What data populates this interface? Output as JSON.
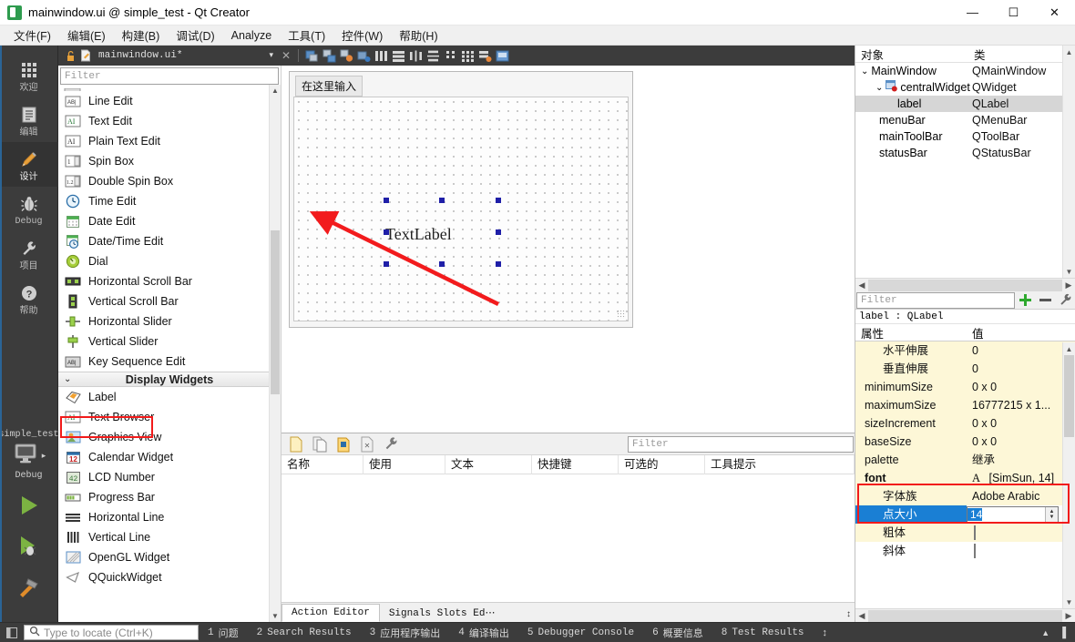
{
  "window": {
    "title": "mainwindow.ui @ simple_test - Qt Creator",
    "app_icon": "qt-creator-icon",
    "minimize": "—",
    "maximize": "☐",
    "close": "✕"
  },
  "menubar": {
    "items": [
      {
        "label": "文件(F)",
        "name": "menu-file"
      },
      {
        "label": "编辑(E)",
        "name": "menu-edit"
      },
      {
        "label": "构建(B)",
        "name": "menu-build"
      },
      {
        "label": "调试(D)",
        "name": "menu-debug"
      },
      {
        "label": "Analyze",
        "name": "menu-analyze"
      },
      {
        "label": "工具(T)",
        "name": "menu-tools"
      },
      {
        "label": "控件(W)",
        "name": "menu-window"
      },
      {
        "label": "帮助(H)",
        "name": "menu-help"
      }
    ]
  },
  "modebar": {
    "modes": [
      {
        "label": "欢迎",
        "icon": "grid-icon",
        "active": false
      },
      {
        "label": "编辑",
        "icon": "document-icon",
        "active": false
      },
      {
        "label": "设计",
        "icon": "pencil-icon",
        "active": true
      },
      {
        "label": "Debug",
        "icon": "bug-icon",
        "active": false
      },
      {
        "label": "项目",
        "icon": "wrench-icon",
        "active": false
      },
      {
        "label": "帮助",
        "icon": "question-icon",
        "active": false
      }
    ],
    "kit": {
      "project": "simple_test",
      "build_config": "Debug",
      "icon": "monitor-icon",
      "arrow": "▸"
    },
    "actions": [
      {
        "name": "run-button",
        "icon": "play-icon"
      },
      {
        "name": "debug-button",
        "icon": "play-bug-icon"
      },
      {
        "name": "build-button",
        "icon": "hammer-icon"
      }
    ]
  },
  "designer_toolbar": {
    "lock_icon": "unlock-icon",
    "file_icon": "ui-file-icon",
    "filename": "mainwindow.ui*",
    "dropdown_arrow": "▾",
    "close_label": "✕",
    "buttons": [
      {
        "name": "edit-widgets-button",
        "icon": "edit-widgets-icon"
      },
      {
        "name": "edit-signals-slots-button",
        "icon": "signals-slots-icon"
      },
      {
        "name": "edit-buddies-button",
        "icon": "buddies-icon"
      },
      {
        "name": "edit-tab-order-button",
        "icon": "tab-order-icon"
      },
      {
        "name": "layout-horizontally-button",
        "icon": "layout-h-icon"
      },
      {
        "name": "layout-vertically-button",
        "icon": "layout-v-icon"
      },
      {
        "name": "layout-splitter-h-button",
        "icon": "splitter-h-icon"
      },
      {
        "name": "layout-splitter-v-button",
        "icon": "splitter-v-icon"
      },
      {
        "name": "layout-form-button",
        "icon": "layout-form-icon"
      },
      {
        "name": "layout-grid-button",
        "icon": "layout-grid-icon"
      },
      {
        "name": "break-layout-button",
        "icon": "break-layout-icon"
      },
      {
        "name": "adjust-size-button",
        "icon": "adjust-size-icon"
      }
    ]
  },
  "widgetbox": {
    "filter_placeholder": "Filter",
    "items": [
      {
        "label": "Line Edit",
        "icon": "line-edit-icon"
      },
      {
        "label": "Text Edit",
        "icon": "text-edit-icon"
      },
      {
        "label": "Plain Text Edit",
        "icon": "plain-text-edit-icon"
      },
      {
        "label": "Spin Box",
        "icon": "spin-box-icon"
      },
      {
        "label": "Double Spin Box",
        "icon": "double-spin-box-icon"
      },
      {
        "label": "Time Edit",
        "icon": "time-edit-icon"
      },
      {
        "label": "Date Edit",
        "icon": "date-edit-icon"
      },
      {
        "label": "Date/Time Edit",
        "icon": "date-time-edit-icon"
      },
      {
        "label": "Dial",
        "icon": "dial-icon"
      },
      {
        "label": "Horizontal Scroll Bar",
        "icon": "h-scrollbar-icon"
      },
      {
        "label": "Vertical Scroll Bar",
        "icon": "v-scrollbar-icon"
      },
      {
        "label": "Horizontal Slider",
        "icon": "h-slider-icon"
      },
      {
        "label": "Vertical Slider",
        "icon": "v-slider-icon"
      },
      {
        "label": "Key Sequence Edit",
        "icon": "key-sequence-edit-icon"
      }
    ],
    "category": {
      "label": "Display Widgets",
      "chevron": "⌄"
    },
    "display_items": [
      {
        "label": "Label",
        "icon": "label-icon",
        "highlighted": true
      },
      {
        "label": "Text Browser",
        "icon": "text-browser-icon"
      },
      {
        "label": "Graphics View",
        "icon": "graphics-view-icon"
      },
      {
        "label": "Calendar Widget",
        "icon": "calendar-widget-icon"
      },
      {
        "label": "LCD Number",
        "icon": "lcd-number-icon"
      },
      {
        "label": "Progress Bar",
        "icon": "progress-bar-icon"
      },
      {
        "label": "Horizontal Line",
        "icon": "h-line-icon"
      },
      {
        "label": "Vertical Line",
        "icon": "v-line-icon"
      },
      {
        "label": "OpenGL Widget",
        "icon": "opengl-widget-icon"
      },
      {
        "label": "QQuickWidget",
        "icon": "qquickwidget-icon"
      }
    ]
  },
  "canvas": {
    "menu_placeholder": "在这里输入",
    "label_text": "TextLabel"
  },
  "action_editor": {
    "toolbar": [
      {
        "name": "new-action-button",
        "icon": "new-icon"
      },
      {
        "name": "copy-action-button",
        "icon": "copy-icon"
      },
      {
        "name": "paste-action-button",
        "icon": "paste-icon"
      },
      {
        "name": "delete-action-button",
        "icon": "delete-icon"
      },
      {
        "name": "configure-button",
        "icon": "wrench-icon"
      }
    ],
    "filter_placeholder": "Filter",
    "columns": [
      "名称",
      "使用",
      "文本",
      "快捷键",
      "可选的",
      "工具提示"
    ],
    "tabs": [
      {
        "label": "Action Editor",
        "active": true
      },
      {
        "label": "Signals  Slots Ed⋯",
        "active": false
      }
    ]
  },
  "object_inspector": {
    "columns": [
      "对象",
      "类"
    ],
    "rows": [
      {
        "name": "MainWindow",
        "class": "QMainWindow",
        "indent": 0,
        "expander": "⌄",
        "icon": "",
        "selected": false
      },
      {
        "name": "centralWidget",
        "class": "QWidget",
        "indent": 1,
        "expander": "⌄",
        "icon": "widget-icon",
        "selected": false
      },
      {
        "name": "label",
        "class": "QLabel",
        "indent": 2,
        "expander": "",
        "icon": "",
        "selected": true
      },
      {
        "name": "menuBar",
        "class": "QMenuBar",
        "indent": 1,
        "expander": "",
        "icon": "",
        "selected": false
      },
      {
        "name": "mainToolBar",
        "class": "QToolBar",
        "indent": 1,
        "expander": "",
        "icon": "",
        "selected": false
      },
      {
        "name": "statusBar",
        "class": "QStatusBar",
        "indent": 1,
        "expander": "",
        "icon": "",
        "selected": false
      }
    ]
  },
  "property_editor": {
    "filter_placeholder": "Filter",
    "add_icon": "plus-icon",
    "remove_icon": "minus-icon",
    "config_icon": "wrench-icon",
    "object_line": "label : QLabel",
    "columns": [
      "属性",
      "值"
    ],
    "rows": [
      {
        "name": "水平伸展",
        "value": "0",
        "indent": 2,
        "expander": "",
        "style": "yellow"
      },
      {
        "name": "垂直伸展",
        "value": "0",
        "indent": 2,
        "expander": "",
        "style": "yellow"
      },
      {
        "name": "minimumSize",
        "value": "0 x 0",
        "indent": 1,
        "expander": "›",
        "style": "yellow"
      },
      {
        "name": "maximumSize",
        "value": "16777215 x 1...",
        "indent": 1,
        "expander": "›",
        "style": "yellow"
      },
      {
        "name": "sizeIncrement",
        "value": "0 x 0",
        "indent": 1,
        "expander": "›",
        "style": "yellow"
      },
      {
        "name": "baseSize",
        "value": "0 x 0",
        "indent": 1,
        "expander": "›",
        "style": "yellow"
      },
      {
        "name": "palette",
        "value": "继承",
        "indent": 1,
        "expander": "",
        "style": "yellow"
      },
      {
        "name": "font",
        "value": "[SimSun, 14]",
        "value_prefix": "A",
        "indent": 1,
        "expander": "⌄",
        "style": "yellow",
        "bold": true
      },
      {
        "name": "字体族",
        "value": "Adobe Arabic",
        "indent": 2,
        "expander": "",
        "style": "yellow"
      },
      {
        "name": "点大小",
        "value": "14",
        "indent": 2,
        "expander": "",
        "style": "editing",
        "editing": true
      },
      {
        "name": "粗体",
        "value": "",
        "indent": 2,
        "expander": "",
        "style": "yellow",
        "checkbox": true
      },
      {
        "name": "斜体",
        "value": "",
        "indent": 2,
        "expander": "",
        "style": "white",
        "checkbox": true
      }
    ]
  },
  "statusbar": {
    "toggle_icon": "sidebar-toggle-icon",
    "search_placeholder": "Type to locate (Ctrl+K)",
    "search_icon": "search-icon",
    "panes": [
      {
        "num": "1",
        "label": "问题"
      },
      {
        "num": "2",
        "label": "Search Results"
      },
      {
        "num": "3",
        "label": "应用程序输出"
      },
      {
        "num": "4",
        "label": "编译输出"
      },
      {
        "num": "5",
        "label": "Debugger Console"
      },
      {
        "num": "6",
        "label": "概要信息"
      },
      {
        "num": "8",
        "label": "Test Results"
      }
    ],
    "spinner": "↕",
    "up_arrow": "▲",
    "right_toggle": "▐"
  },
  "colors": {
    "accent_blue": "#1a7fd4",
    "annotation_red": "#f21b1d",
    "dark_chrome": "#3c3c3c",
    "property_yellow": "#fdf7d7",
    "handle_blue": "#1f1fa8"
  }
}
